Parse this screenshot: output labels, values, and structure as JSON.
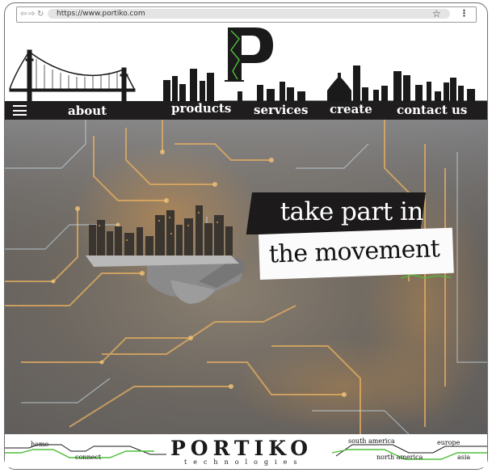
{
  "browser": {
    "url": "https://www.portiko.com"
  },
  "header": {
    "logo_letter": "P"
  },
  "nav": {
    "about": "about",
    "products": "products",
    "services": "services",
    "create": "create",
    "contact": "contact us"
  },
  "hero": {
    "line1": "take part in",
    "line2": "the movement"
  },
  "footer": {
    "brand": "PORTIKO",
    "brand_sub": "technologies",
    "links": {
      "home": "home",
      "connect": "connect",
      "south_america": "south america",
      "north_america": "north america",
      "europe": "europe",
      "asia": "asia"
    }
  },
  "colors": {
    "accent": "#4fbf3a",
    "dark": "#1f1d1e"
  }
}
